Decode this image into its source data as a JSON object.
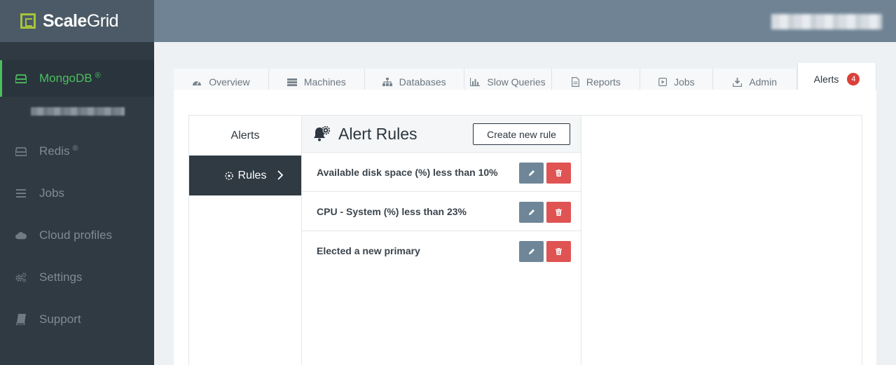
{
  "brand": {
    "name_bold": "Scale",
    "name_light": "Grid"
  },
  "sidebar": {
    "items": [
      {
        "label": "MongoDB",
        "sup": "®",
        "icon": "database-icon",
        "active": true
      },
      {
        "label": "Redis",
        "sup": "®",
        "icon": "database-icon",
        "active": false
      },
      {
        "label": "Jobs",
        "sup": "",
        "icon": "list-icon",
        "active": false
      },
      {
        "label": "Cloud profiles",
        "sup": "",
        "icon": "cloud-icon",
        "active": false
      },
      {
        "label": "Settings",
        "sup": "",
        "icon": "gears-icon",
        "active": false
      },
      {
        "label": "Support",
        "sup": "",
        "icon": "book-icon",
        "active": false
      }
    ]
  },
  "tabs": [
    {
      "label": "Overview",
      "icon": "dashboard-icon"
    },
    {
      "label": "Machines",
      "icon": "server-icon"
    },
    {
      "label": "Databases",
      "icon": "sitemap-icon"
    },
    {
      "label": "Slow Queries",
      "icon": "bar-chart-icon"
    },
    {
      "label": "Reports",
      "icon": "document-icon"
    },
    {
      "label": "Jobs",
      "icon": "play-square-icon"
    },
    {
      "label": "Admin",
      "icon": "download-icon"
    },
    {
      "label": "Alerts",
      "icon": "",
      "badge": "4",
      "active": true
    }
  ],
  "alerts_menu": {
    "alerts_label": "Alerts",
    "rules_label": "Rules"
  },
  "rules_panel": {
    "title": "Alert Rules",
    "create_button": "Create new rule",
    "rules": [
      {
        "text": "Available disk space (%) less than 10%"
      },
      {
        "text": "CPU - System (%) less than 23%"
      },
      {
        "text": "Elected a new primary"
      }
    ]
  },
  "colors": {
    "sidebar_bg": "#2f3a43",
    "topbar_bg": "#6f8394",
    "accent_green": "#4bbf5f",
    "logo_green": "#a6c43b",
    "edit_button": "#6e8697",
    "delete_button": "#e05353",
    "badge_red": "#d9403a"
  }
}
